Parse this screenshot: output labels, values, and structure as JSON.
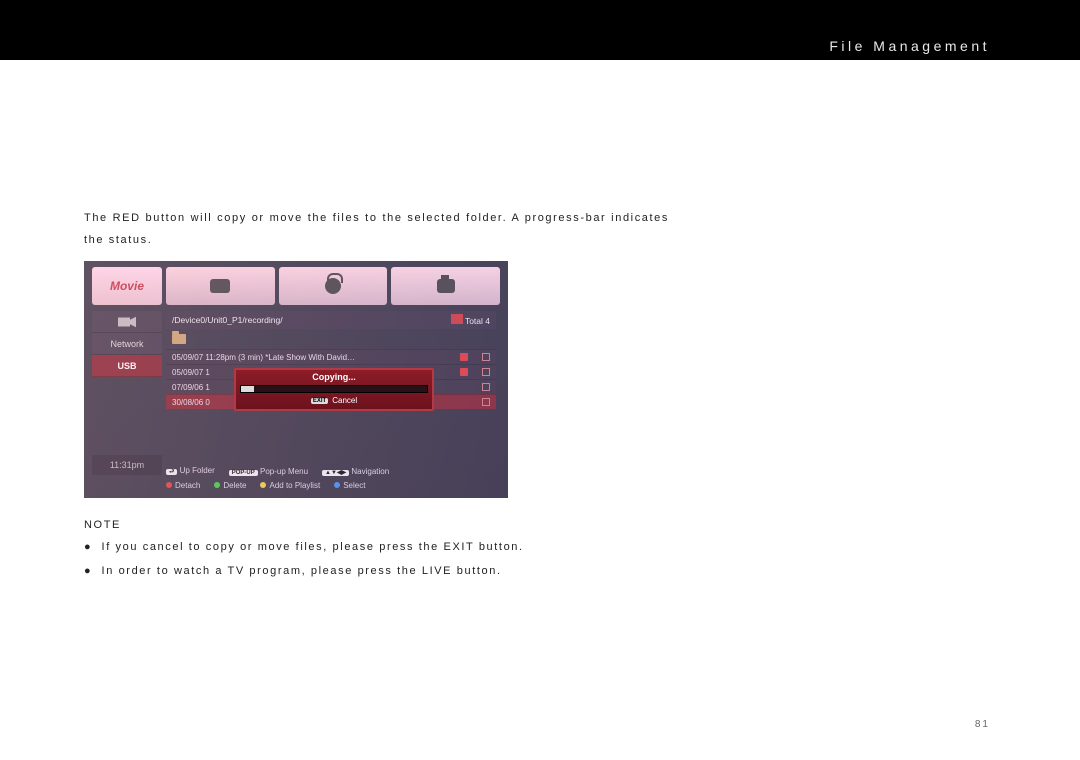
{
  "header": {
    "title": "File Management"
  },
  "page_number": "81",
  "body": {
    "para1": "The RED button will copy or move the files to the selected folder. A progress-bar indicates the status.",
    "note_label": "NOTE",
    "note_bullet1": "●  If you cancel to copy or move files, please press the EXIT button.",
    "note_bullet2": "●  In order to watch a TV program, please press the LIVE button."
  },
  "tv": {
    "tab_left_label": "Movie",
    "sidebar": {
      "network_label": "Network",
      "usb_label": "USB",
      "clock": "11:31pm"
    },
    "path": "/Device0/Unit0_P1/recording/",
    "total_label": "Total 4",
    "rows": [
      {
        "text": "05/09/07 11:28pm (3 min) *Late Show With David…",
        "tagged": true
      },
      {
        "text": "05/09/07 1",
        "tagged": true
      },
      {
        "text": "07/09/06 1",
        "tagged": false
      },
      {
        "text": "30/08/06 0",
        "tagged": false,
        "selected": true
      }
    ],
    "copying": {
      "caption": "Copying...",
      "cancel_label": "Cancel",
      "exit_key": "EXIT"
    },
    "hints_top": {
      "up_folder_key": "⮐",
      "up_folder": "Up Folder",
      "popup_key": "POP-UP",
      "popup": "Pop-up Menu",
      "nav_key": "▲▼◀▶",
      "nav": "Navigation"
    },
    "hints_bottom": {
      "detach": "Detach",
      "delete": "Delete",
      "addpl": "Add to Playlist",
      "select": "Select"
    }
  }
}
